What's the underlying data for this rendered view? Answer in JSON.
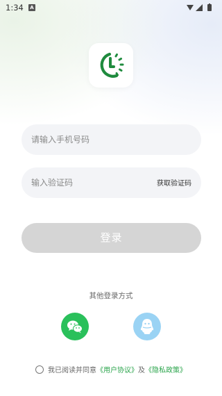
{
  "status_bar": {
    "time": "1:34",
    "notification_badge": "A"
  },
  "colors": {
    "brand_green": "#2aa44b",
    "wechat_green": "#2ac05b",
    "qq_blue": "#9ad3f4",
    "input_bg": "#f3f4f7",
    "disabled_button": "#d5d5d5"
  },
  "phone": {
    "placeholder": "请输入手机号码"
  },
  "code": {
    "placeholder": "输入验证码",
    "get_code_label": "获取验证码"
  },
  "login": {
    "button_label": "登录"
  },
  "other_login": {
    "title": "其他登录方式",
    "options": [
      {
        "icon": "wechat-icon"
      },
      {
        "icon": "qq-icon"
      }
    ]
  },
  "agreement": {
    "prefix": "我已阅读并同意",
    "user_agreement": "《用户协议》",
    "and": "及",
    "privacy_policy": "《隐私政策》"
  }
}
